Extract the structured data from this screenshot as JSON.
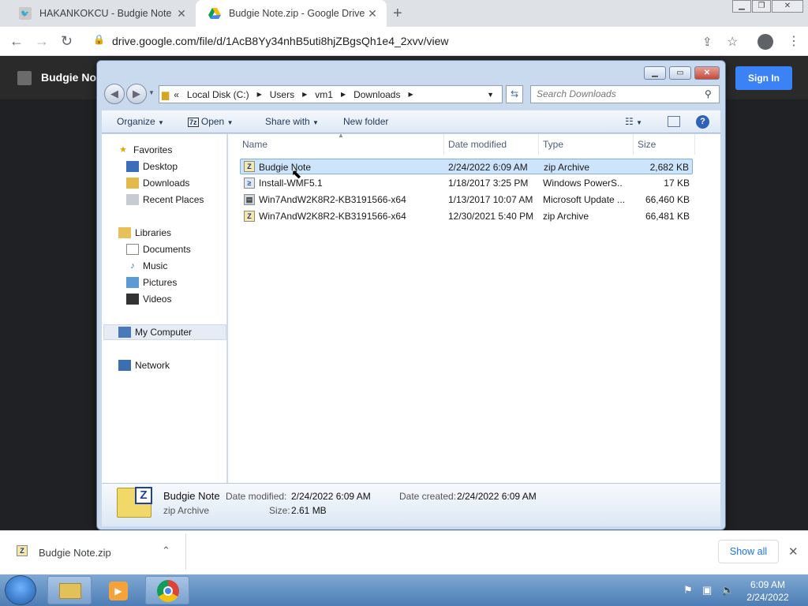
{
  "browser": {
    "tabs": [
      {
        "title": "HAKANKOKCU - Budgie Note",
        "close": "✕"
      },
      {
        "title": "Budgie Note.zip - Google Drive",
        "close": "✕"
      }
    ],
    "new_tab": "+",
    "url": "drive.google.com/file/d/1AcB8Yy34nhB5uti8hjZBgsQh1e4_2xvv/view"
  },
  "drive": {
    "title": "Budgie Note",
    "sign_in": "Sign In"
  },
  "explorer": {
    "breadcrumb": [
      "Local Disk (C:)",
      "Users",
      "vm1",
      "Downloads"
    ],
    "search_placeholder": "Search Downloads",
    "commands": {
      "organize": "Organize",
      "open": "Open",
      "share_with": "Share with",
      "new_folder": "New folder"
    },
    "nav": {
      "favorites": "Favorites",
      "desktop": "Desktop",
      "downloads": "Downloads",
      "recent_places": "Recent Places",
      "libraries": "Libraries",
      "documents": "Documents",
      "music": "Music",
      "pictures": "Pictures",
      "videos": "Videos",
      "my_computer": "My Computer",
      "network": "Network"
    },
    "columns": {
      "name": "Name",
      "date_modified": "Date modified",
      "type": "Type",
      "size": "Size"
    },
    "files": [
      {
        "name": "Budgie Note",
        "date": "2/24/2022 6:09 AM",
        "type": "zip Archive",
        "size": "2,682 KB"
      },
      {
        "name": "Install-WMF5.1",
        "date": "1/18/2017 3:25 PM",
        "type": "Windows PowerS...",
        "size": "17 KB"
      },
      {
        "name": "Win7AndW2K8R2-KB3191566-x64",
        "date": "1/13/2017 10:07 AM",
        "type": "Microsoft Update ...",
        "size": "66,460 KB"
      },
      {
        "name": "Win7AndW2K8R2-KB3191566-x64",
        "date": "12/30/2021 5:40 PM",
        "type": "zip Archive",
        "size": "66,481 KB"
      }
    ],
    "details": {
      "name": "Budgie Note",
      "type": "zip Archive",
      "date_modified_label": "Date modified:",
      "date_modified": "2/24/2022 6:09 AM",
      "size_label": "Size:",
      "size": "2.61 MB",
      "date_created_label": "Date created:",
      "date_created": "2/24/2022 6:09 AM"
    }
  },
  "downloads_bar": {
    "file": "Budgie Note.zip",
    "show_all": "Show all"
  },
  "taskbar": {
    "time": "6:09 AM",
    "date": "2/24/2022"
  }
}
